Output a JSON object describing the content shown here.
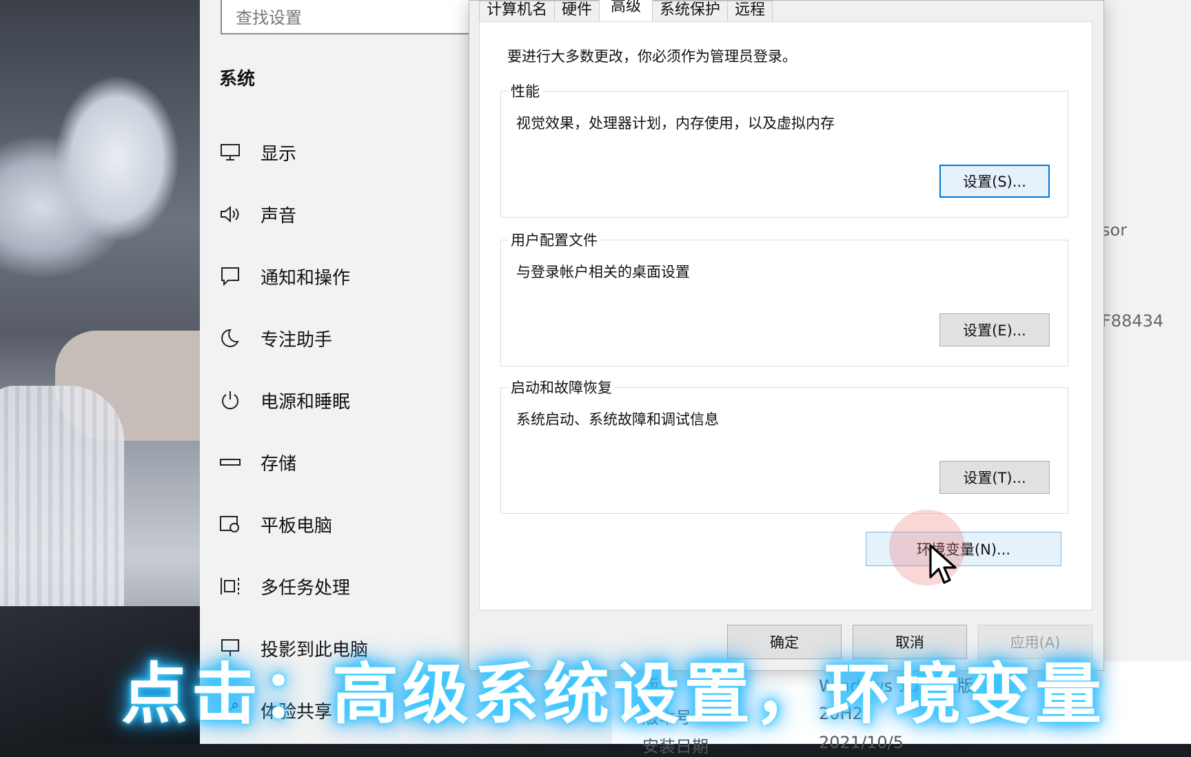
{
  "settings": {
    "search_placeholder": "查找设置",
    "section_title": "系统",
    "nav": [
      {
        "label": "显示",
        "icon": "monitor-icon"
      },
      {
        "label": "声音",
        "icon": "speaker-icon"
      },
      {
        "label": "通知和操作",
        "icon": "notification-icon"
      },
      {
        "label": "专注助手",
        "icon": "moon-icon"
      },
      {
        "label": "电源和睡眠",
        "icon": "power-icon"
      },
      {
        "label": "存储",
        "icon": "storage-icon"
      },
      {
        "label": "平板电脑",
        "icon": "tablet-icon"
      },
      {
        "label": "多任务处理",
        "icon": "multitask-icon"
      },
      {
        "label": "投影到此电脑",
        "icon": "project-icon"
      },
      {
        "label": "体验共享",
        "icon": "share-icon"
      }
    ],
    "right_fragments": {
      "processor": "sor",
      "device_id": "F88434"
    },
    "about": {
      "edition_label": "版本",
      "edition_value": "Windows 10 专业版",
      "version_label": "版本号",
      "version_value": "20H2",
      "install_label": "安装日期",
      "install_value": "2021/10/5"
    }
  },
  "dialog": {
    "tabs": [
      "计算机名",
      "硬件",
      "高级",
      "系统保护",
      "远程"
    ],
    "active_tab": "高级",
    "admin_note": "要进行大多数更改，你必须作为管理员登录。",
    "groups": [
      {
        "title": "性能",
        "desc": "视觉效果，处理器计划，内存使用，以及虚拟内存",
        "button": "设置(S)..."
      },
      {
        "title": "用户配置文件",
        "desc": "与登录帐户相关的桌面设置",
        "button": "设置(E)..."
      },
      {
        "title": "启动和故障恢复",
        "desc": "系统启动、系统故障和调试信息",
        "button": "设置(T)..."
      }
    ],
    "env_button": "环境变量(N)...",
    "footer": {
      "ok": "确定",
      "cancel": "取消",
      "apply": "应用(A)"
    }
  },
  "caption": "点击：高级系统设置，环境变量",
  "colors": {
    "accent": "#0078d7",
    "caption_glow": "#3fd0ff"
  }
}
